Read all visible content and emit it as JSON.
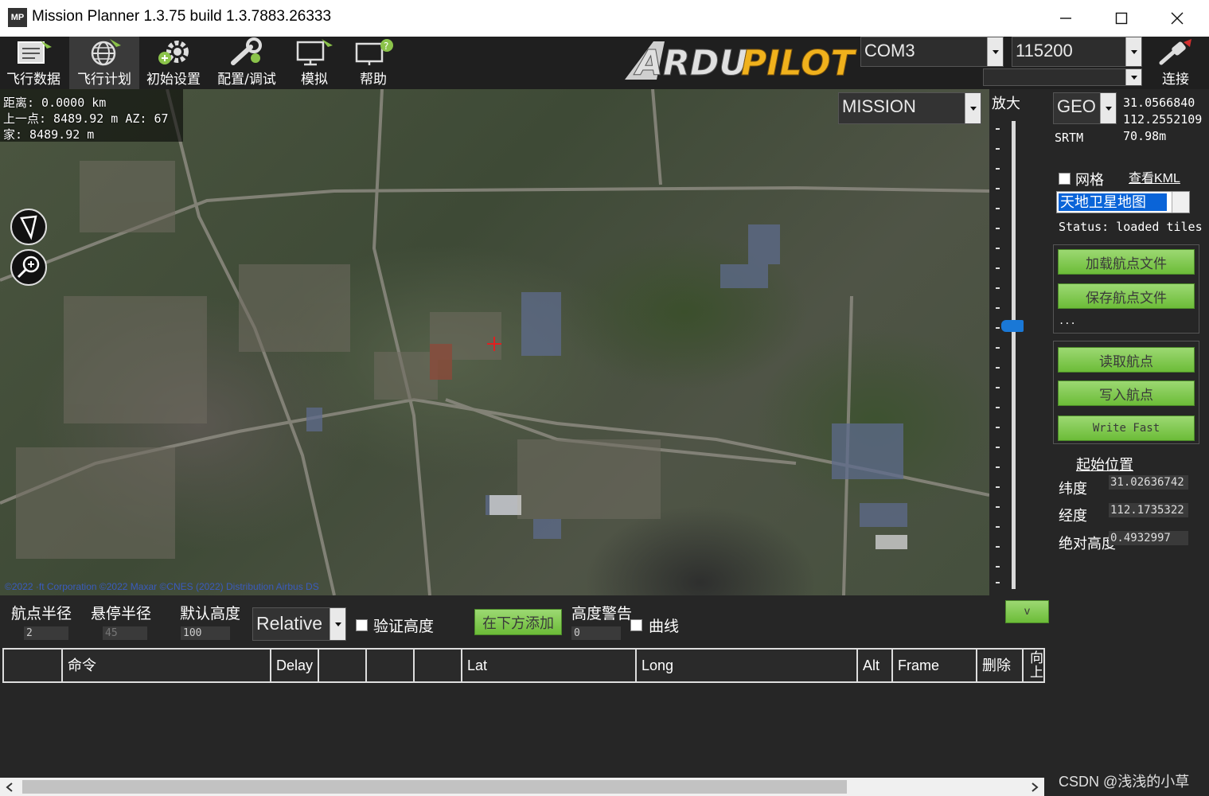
{
  "window": {
    "title": "Mission Planner 1.3.75 build 1.3.7883.26333",
    "icon_text": "MP"
  },
  "toolbar": {
    "items": [
      {
        "label": "飞行数据",
        "icon": "flight-data-icon"
      },
      {
        "label": "飞行计划",
        "icon": "flight-plan-icon",
        "active": true
      },
      {
        "label": "初始设置",
        "icon": "initial-setup-icon"
      },
      {
        "label": "配置/调试",
        "icon": "config-tuning-icon"
      },
      {
        "label": "模拟",
        "icon": "simulation-icon"
      },
      {
        "label": "帮助",
        "icon": "help-icon"
      }
    ],
    "logo": "ARDUPILOT",
    "port": "COM3",
    "baud": "115200",
    "connect_label": "连接"
  },
  "map": {
    "distance": "距离:  0.0000 km",
    "prev_point": "上一点:  8489.92 m  AZ: 67",
    "home": "家:  8489.92 m",
    "copyright": "©2022 ·ft Corporation ©2022 Maxar ©CNES (2022) Distribution Airbus DS",
    "mode": "MISSION",
    "zoom_label": "放大"
  },
  "right_panel": {
    "coord_type": "GEO",
    "lat": "31.0566840",
    "lng": "112.2552109",
    "srtm_label": "SRTM",
    "srtm_value": "70.98m",
    "grid_label": "网格",
    "view_kml": "查看KML",
    "map_provider": "天地卫星地图",
    "status": "Status: loaded tiles",
    "load_wp_file": "加载航点文件",
    "save_wp_file": "保存航点文件",
    "ellipsis": "...",
    "read_wp": "读取航点",
    "write_wp": "写入航点",
    "write_fast": "Write Fast",
    "home_title": "起始位置",
    "home_lat_label": "纬度",
    "home_lat": "31.02636742",
    "home_lng_label": "经度",
    "home_lng": "112.1735322",
    "home_alt_label": "绝对高度",
    "home_alt": "0.4932997"
  },
  "bottom": {
    "wp_radius_label": "航点半径",
    "wp_radius": "2",
    "loiter_radius_label": "悬停半径",
    "loiter_radius": "45",
    "default_alt_label": "默认高度",
    "default_alt": "100",
    "alt_frame": "Relative",
    "verify_height": "验证高度",
    "add_below": "在下方添加",
    "alt_warn_label": "高度警告",
    "alt_warn": "0",
    "spline": "曲线",
    "collapse": "v",
    "columns": [
      "",
      "命令",
      "Delay",
      "",
      "",
      "",
      "Lat",
      "Long",
      "Alt",
      "Frame",
      "删除",
      "向上"
    ]
  },
  "watermark": "CSDN @浅浅的小草"
}
